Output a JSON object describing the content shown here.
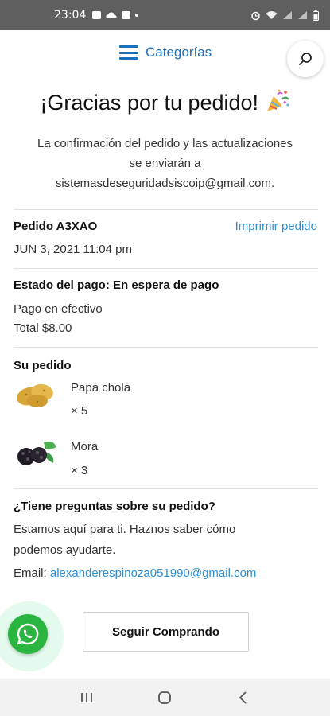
{
  "status_bar": {
    "time": "23:04"
  },
  "nav": {
    "categories_label": "Categorías"
  },
  "confirmation": {
    "title": "¡Gracias por tu pedido!",
    "message_line1": "La confirmación del pedido y las actualizaciones",
    "message_line2": "se enviarán a",
    "email": "sistemasdeseguridadsiscoip@gmail.com."
  },
  "order": {
    "id_label": "Pedido A3XAO",
    "print_label": "Imprimir pedido",
    "date": "JUN 3, 2021 11:04 pm"
  },
  "payment": {
    "status": "Estado del pago: En espera de pago",
    "method": "Pago en efectivo",
    "total": "Total $8.00"
  },
  "items_section": {
    "heading": "Su pedido",
    "items": [
      {
        "name": "Papa chola",
        "qty": "× 5",
        "icon": "potato-image"
      },
      {
        "name": "Mora",
        "qty": "× 3",
        "icon": "blackberry-image"
      }
    ]
  },
  "help": {
    "heading": "¿Tiene preguntas sobre su pedido?",
    "line1": "Estamos aquí para ti. Haznos saber cómo",
    "line2": "podemos ayudarte.",
    "email_label": "Email:",
    "email": "alexanderespinoza051990@gmail.com"
  },
  "actions": {
    "continue_label": "Seguir Comprando"
  },
  "colors": {
    "accent": "#1b6fbb",
    "link": "#2f8fd0",
    "whatsapp": "#2ab540"
  }
}
